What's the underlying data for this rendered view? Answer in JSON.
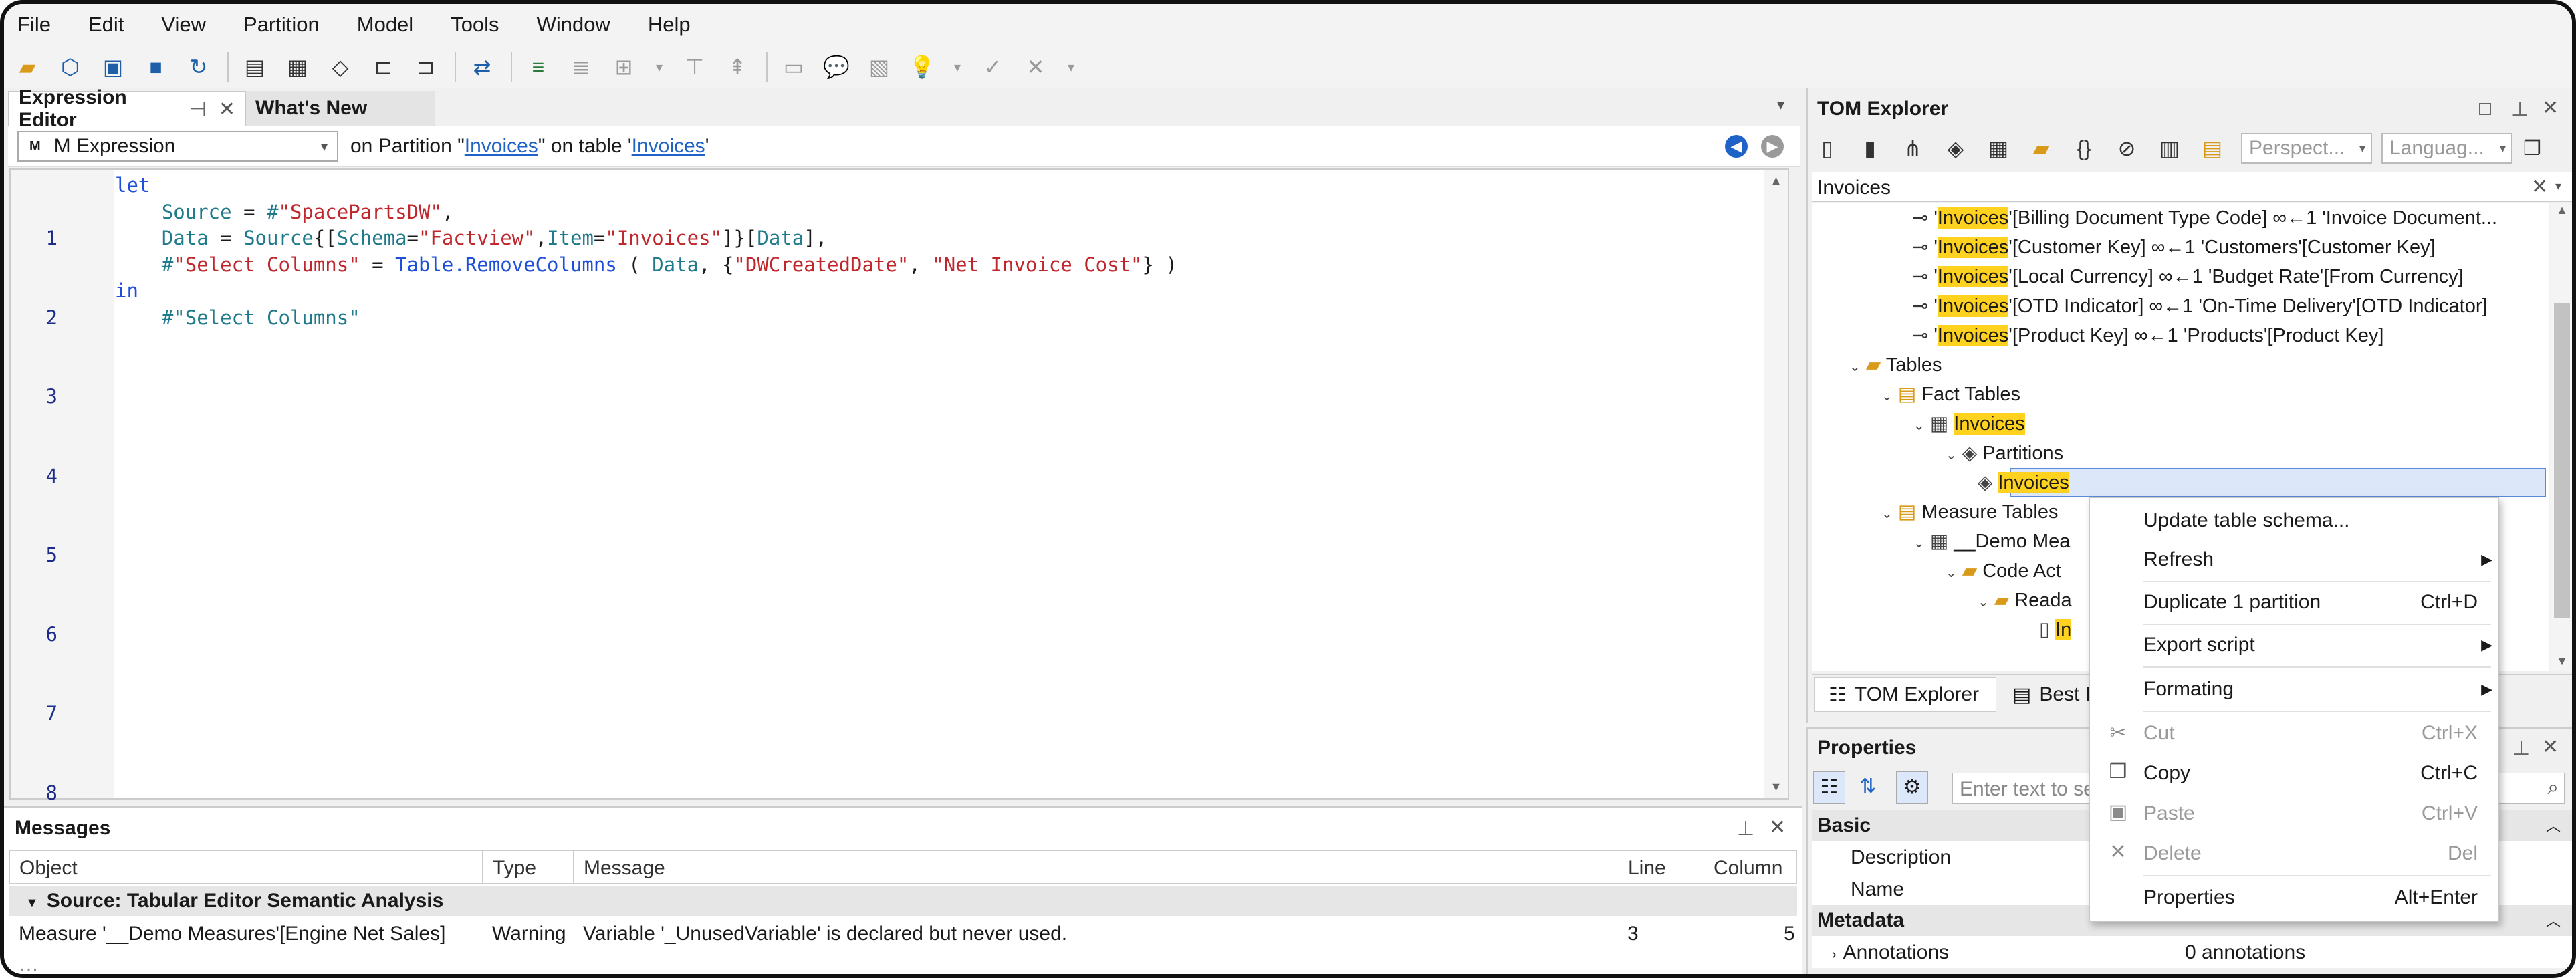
{
  "menu": [
    "File",
    "Edit",
    "View",
    "Partition",
    "Model",
    "Tools",
    "Window",
    "Help"
  ],
  "editor": {
    "tabs": [
      "Expression Editor",
      "What's New"
    ],
    "expr_type": "M Expression",
    "context_prefix": "on Partition \"",
    "partition_link": "Invoices",
    "context_mid": "\" on table '",
    "table_link": "Invoices",
    "context_suffix": "'",
    "lines": [
      "1",
      "2",
      "3",
      "4",
      "5",
      "6",
      "7",
      "8"
    ]
  },
  "messages": {
    "title": "Messages",
    "headers": [
      "Object",
      "Type",
      "Message",
      "Line",
      "Column"
    ],
    "group": "Source: Tabular Editor Semantic Analysis",
    "rows": [
      {
        "object": "Measure '__Demo Measures'[Engine Net Sales]",
        "type": "Warning",
        "message": "Variable '_UnusedVariable' is declared but never used.",
        "line": "3",
        "column": "5"
      }
    ]
  },
  "tom": {
    "title": "TOM Explorer",
    "perspective": "Perspect...",
    "language": "Languag...",
    "search": "Invoices",
    "rels": [
      {
        "hl": "Invoices",
        "rest": "'[Billing Document Type Code] ∞←1 'Invoice Document..."
      },
      {
        "hl": "Invoices",
        "rest": "'[Customer Key] ∞←1 'Customers'[Customer Key]"
      },
      {
        "hl": "Invoices",
        "rest": "'[Local Currency] ∞←1 'Budget Rate'[From Currency]"
      },
      {
        "hl": "Invoices",
        "rest": "'[OTD Indicator] ∞←1 'On-Time Delivery'[OTD Indicator]"
      },
      {
        "hl": "Invoices",
        "rest": "'[Product Key] ∞←1 'Products'[Product Key]"
      }
    ],
    "tables": "Tables",
    "fact": "Fact Tables",
    "invoices": "Invoices",
    "partitions": "Partitions",
    "partition": "Invoices",
    "measure_tables": "Measure Tables",
    "demo": "__Demo Mea",
    "code_act": "Code Act",
    "reada": "Reada",
    "inv_short": "In",
    "bottom_tabs": [
      "TOM Explorer",
      "Best P"
    ]
  },
  "properties": {
    "title": "Properties",
    "search_placeholder": "Enter text to se",
    "basic": "Basic",
    "description": "Description",
    "name": "Name",
    "metadata": "Metadata",
    "annotations": "Annotations",
    "annotations_val": "0 annotations"
  },
  "context_menu": [
    {
      "label": "Update table schema...",
      "shortcut": ""
    },
    {
      "label": "Refresh",
      "shortcut": ""
    },
    {
      "label": "Duplicate 1 partition",
      "shortcut": "Ctrl+D"
    },
    {
      "label": "Export script",
      "shortcut": ""
    },
    {
      "label": "Formating",
      "shortcut": ""
    },
    {
      "label": "Cut",
      "shortcut": "Ctrl+X"
    },
    {
      "label": "Copy",
      "shortcut": "Ctrl+C"
    },
    {
      "label": "Paste",
      "shortcut": "Ctrl+V"
    },
    {
      "label": "Delete",
      "shortcut": "Del"
    },
    {
      "label": "Properties",
      "shortcut": "Alt+Enter"
    }
  ]
}
